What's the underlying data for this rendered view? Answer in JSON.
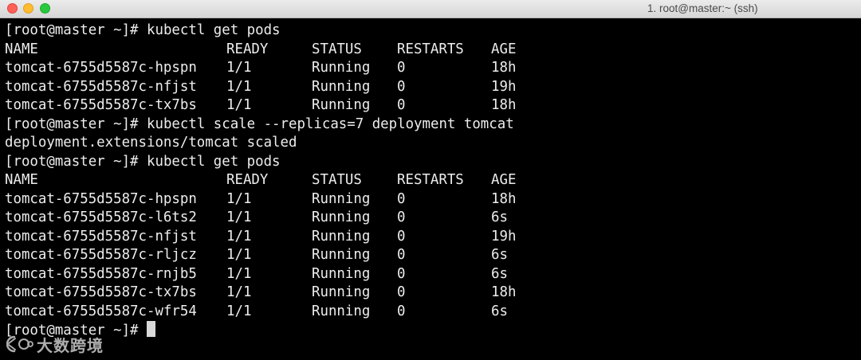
{
  "window": {
    "title": "1. root@master:~ (ssh)"
  },
  "terminal": {
    "prompt": "[root@master ~]# ",
    "block1": {
      "command": "kubectl get pods",
      "headers": [
        "NAME",
        "READY",
        "STATUS",
        "RESTARTS",
        "AGE"
      ],
      "rows": [
        [
          "tomcat-6755d5587c-hpspn",
          "1/1",
          "Running",
          "0",
          "18h"
        ],
        [
          "tomcat-6755d5587c-nfjst",
          "1/1",
          "Running",
          "0",
          "19h"
        ],
        [
          "tomcat-6755d5587c-tx7bs",
          "1/1",
          "Running",
          "0",
          "18h"
        ]
      ]
    },
    "block2": {
      "command": "kubectl scale --replicas=7 deployment tomcat",
      "output": "deployment.extensions/tomcat scaled"
    },
    "block3": {
      "command": "kubectl get pods",
      "headers": [
        "NAME",
        "READY",
        "STATUS",
        "RESTARTS",
        "AGE"
      ],
      "rows": [
        [
          "tomcat-6755d5587c-hpspn",
          "1/1",
          "Running",
          "0",
          "18h"
        ],
        [
          "tomcat-6755d5587c-l6ts2",
          "1/1",
          "Running",
          "0",
          "6s"
        ],
        [
          "tomcat-6755d5587c-nfjst",
          "1/1",
          "Running",
          "0",
          "19h"
        ],
        [
          "tomcat-6755d5587c-rljcz",
          "1/1",
          "Running",
          "0",
          "6s"
        ],
        [
          "tomcat-6755d5587c-rnjb5",
          "1/1",
          "Running",
          "0",
          "6s"
        ],
        [
          "tomcat-6755d5587c-tx7bs",
          "1/1",
          "Running",
          "0",
          "18h"
        ],
        [
          "tomcat-6755d5587c-wfr54",
          "1/1",
          "Running",
          "0",
          "6s"
        ]
      ]
    }
  },
  "watermark": {
    "text": "大数跨境"
  }
}
